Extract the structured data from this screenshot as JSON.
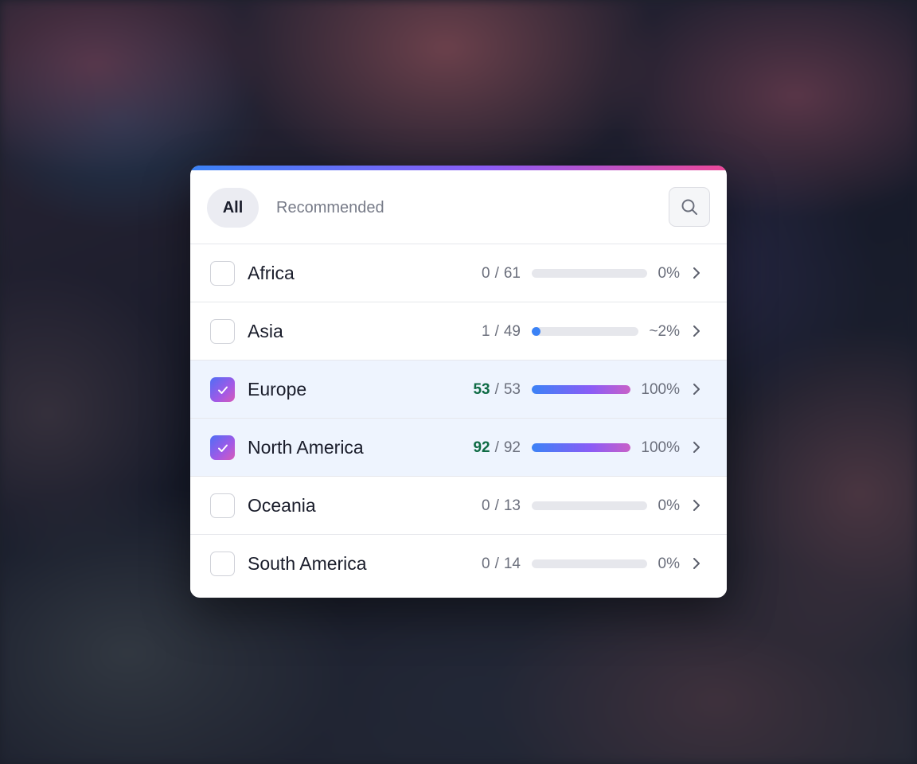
{
  "tabs": {
    "all_label": "All",
    "recommended_label": "Recommended"
  },
  "search": {
    "icon": "search-icon"
  },
  "colors": {
    "accent_start": "#3b82f6",
    "accent_mid": "#8b5cf6",
    "accent_end": "#ec4899",
    "complete_count": "#0f6b45",
    "selected_row_bg": "#eef4fe"
  },
  "regions": [
    {
      "name": "Africa",
      "done": "0",
      "total": "61",
      "progress": 0,
      "percent_label": "0%",
      "checked": false
    },
    {
      "name": "Asia",
      "done": "1",
      "total": "49",
      "progress": 0.02,
      "percent_label": "~2%",
      "checked": false
    },
    {
      "name": "Europe",
      "done": "53",
      "total": "53",
      "progress": 1,
      "percent_label": "100%",
      "checked": true
    },
    {
      "name": "North America",
      "done": "92",
      "total": "92",
      "progress": 1,
      "percent_label": "100%",
      "checked": true
    },
    {
      "name": "Oceania",
      "done": "0",
      "total": "13",
      "progress": 0,
      "percent_label": "0%",
      "checked": false
    },
    {
      "name": "South America",
      "done": "0",
      "total": "14",
      "progress": 0,
      "percent_label": "0%",
      "checked": false
    }
  ]
}
